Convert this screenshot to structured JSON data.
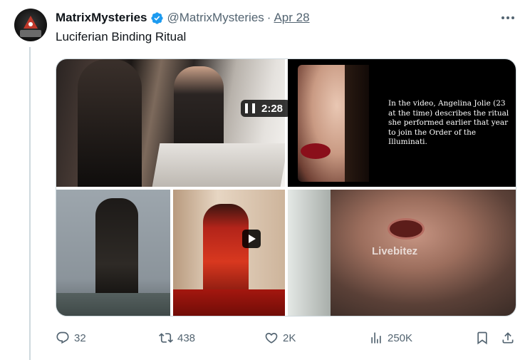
{
  "tweet": {
    "author_name": "MatrixMysteries",
    "handle": "@MatrixMysteries",
    "separator": "·",
    "date": "Apr 28",
    "text": "Luciferian Binding Ritual"
  },
  "media": {
    "video_quote": "In the video, Angelina Jolie (23 at the time) describes the ritual she performed earlier that year to join the Order of the Illuminati.",
    "video_time": "2:28",
    "watermark": "Livebitez"
  },
  "actions": {
    "replies": "32",
    "retweets": "438",
    "likes": "2K",
    "views": "250K"
  },
  "colors": {
    "verified": "#1d9bf0",
    "secondary_text": "#536471",
    "primary_text": "#0f1419"
  },
  "icons": [
    "avatar-eye-icon",
    "verified-badge-icon",
    "more-options-icon",
    "pause-icon",
    "play-icon",
    "reply-icon",
    "retweet-icon",
    "like-icon",
    "views-icon",
    "bookmark-icon",
    "share-icon"
  ]
}
